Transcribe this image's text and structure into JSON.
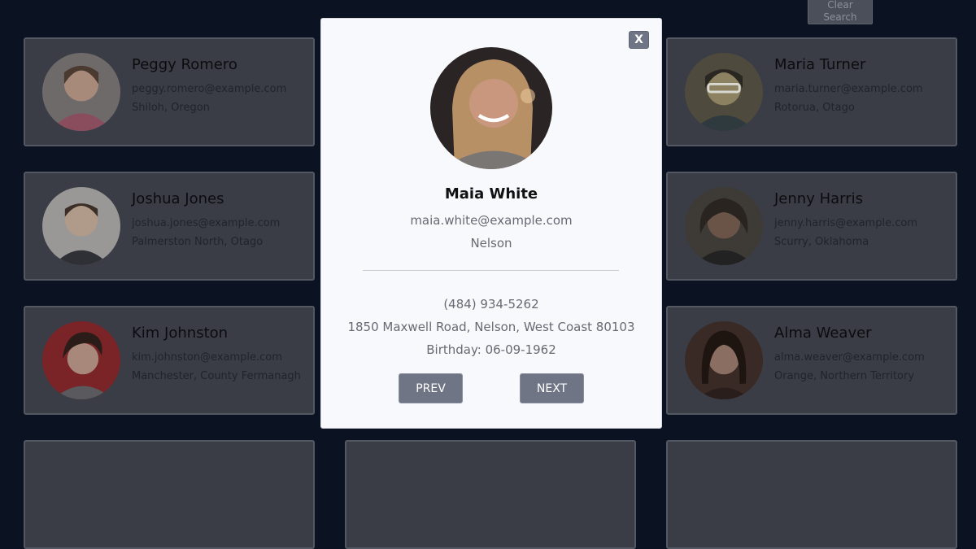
{
  "search": {
    "clear_line1": "Clear",
    "clear_line2": "Search"
  },
  "cards": [
    {
      "name": "Peggy Romero",
      "email": "peggy.romero@example.com",
      "location": "Shiloh, Oregon",
      "photo_color": "#a88a7a"
    },
    {
      "name": "Maria Turner",
      "email": "maria.turner@example.com",
      "location": "Rotorua, Otago",
      "photo_color": "#8c8262"
    },
    {
      "name": "Joshua Jones",
      "email": "joshua.jones@example.com",
      "location": "Palmerston North, Otago",
      "photo_color": "#9a9896"
    },
    {
      "name": "Jenny Harris",
      "email": "jenny.harris@example.com",
      "location": "Scurry, Oklahoma",
      "photo_color": "#5e544a"
    },
    {
      "name": "Kim Johnston",
      "email": "kim.johnston@example.com",
      "location": "Manchester, County Fermanagh",
      "photo_color": "#8a2c30"
    },
    {
      "name": "Alma Weaver",
      "email": "alma.weaver@example.com",
      "location": "Orange, Northern Territory",
      "photo_color": "#4e3c34"
    }
  ],
  "modal": {
    "close_label": "X",
    "name": "Maia White",
    "email": "maia.white@example.com",
    "city": "Nelson",
    "phone": "(484) 934-5262",
    "address": "1850 Maxwell Road, Nelson, West Coast 80103",
    "birthday": "Birthday: 06-09-1962",
    "prev_label": "PREV",
    "next_label": "NEXT",
    "photo_color": "#8a6c5a"
  }
}
